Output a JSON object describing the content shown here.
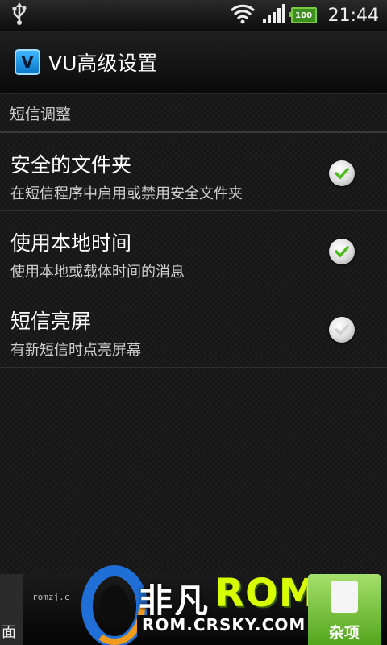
{
  "status_bar": {
    "time": "21:44",
    "battery": "100",
    "icons": [
      "usb-icon",
      "wifi-icon",
      "signal-icon",
      "battery-icon"
    ]
  },
  "app_bar": {
    "title": "VU高级设置",
    "icon_letter": "V"
  },
  "section": {
    "title": "短信调整"
  },
  "prefs": [
    {
      "title": "安全的文件夹",
      "summary": "在短信程序中启用或禁用安全文件夹",
      "checked": true
    },
    {
      "title": "使用本地时间",
      "summary": "使用本地或载体时间的消息",
      "checked": true
    },
    {
      "title": "短信亮屏",
      "summary": "有新短信时点亮屏幕",
      "checked": false
    }
  ],
  "watermark": {
    "brand_cn": "非凡",
    "brand_rom": "ROM",
    "url": "ROM.CRSKY.COM"
  },
  "dock": {
    "left_label": "面",
    "small_text": "romzj.c",
    "misc_label": "杂项"
  },
  "colors": {
    "accent_check": "#5ac41e",
    "brand_rom": "#d8ff00",
    "misc_tab": "#7cc640"
  }
}
